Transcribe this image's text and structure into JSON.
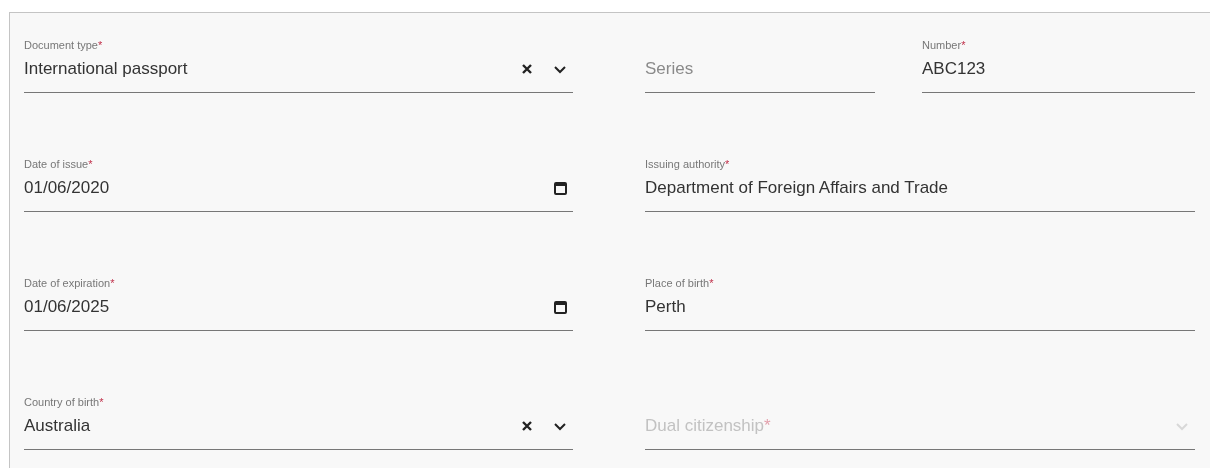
{
  "rows": [
    {
      "left": {
        "kind": "select",
        "label": "Document type",
        "asterisk": "*",
        "value": "International passport",
        "clearable": true,
        "disabled": false
      },
      "right": [
        {
          "kind": "text",
          "placeholder": "Series",
          "disabled": false
        },
        {
          "kind": "text",
          "label": "Number",
          "asterisk": "*",
          "value": "ABC123",
          "disabled": false
        }
      ]
    },
    {
      "left": {
        "kind": "date",
        "label": "Date of issue",
        "asterisk": "*",
        "value": "01/06/2020",
        "disabled": false
      },
      "right": [
        {
          "kind": "text",
          "label": "Issuing authority",
          "asterisk": "*",
          "value": "Department of Foreign Affairs and Trade",
          "disabled": false
        }
      ]
    },
    {
      "left": {
        "kind": "date",
        "label": "Date of expiration",
        "asterisk": "*",
        "value": "01/06/2025",
        "disabled": false
      },
      "right": [
        {
          "kind": "text",
          "label": "Place of birth",
          "asterisk": "*",
          "value": "Perth",
          "disabled": false
        }
      ]
    },
    {
      "left": {
        "kind": "select",
        "label": "Country of birth",
        "asterisk": "*",
        "value": "Australia",
        "clearable": true,
        "disabled": false
      },
      "right": [
        {
          "kind": "select",
          "placeholder": "Dual citizenship",
          "asterisk": "*",
          "clearable": false,
          "disabled": true
        }
      ]
    }
  ]
}
